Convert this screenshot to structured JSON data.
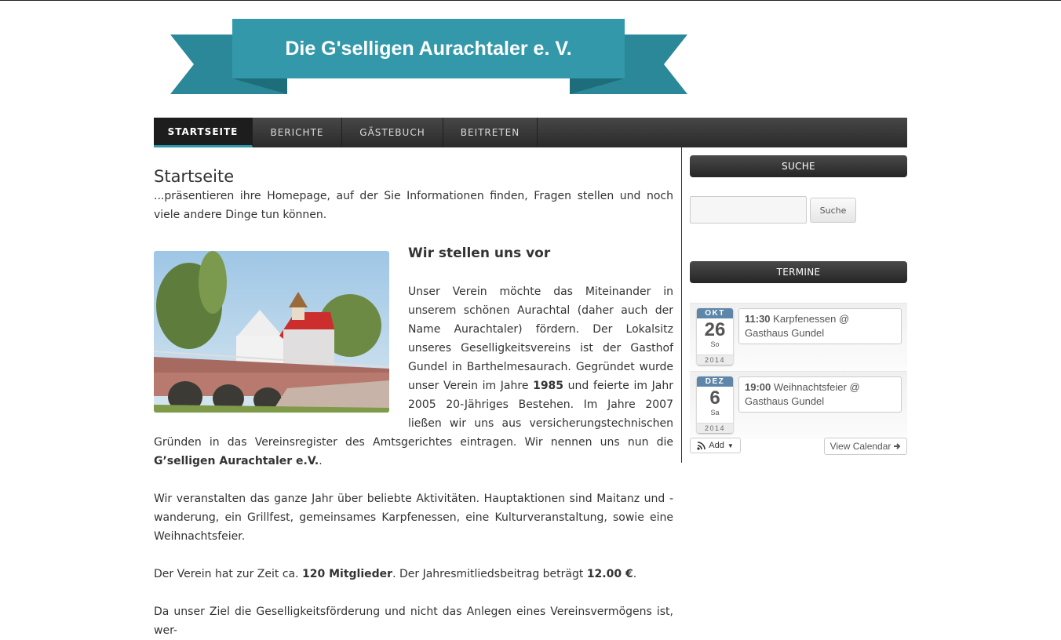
{
  "site": {
    "title": "Die G'selligen Aurachtaler e. V.",
    "banner_color": "#3399aa",
    "banner_dark": "#2a8898"
  },
  "nav": {
    "items": [
      {
        "label": "STARTSEITE",
        "active": true
      },
      {
        "label": "BERICHTE",
        "active": false
      },
      {
        "label": "GÄSTEBUCH",
        "active": false
      },
      {
        "label": "BEITRETEN",
        "active": false
      }
    ]
  },
  "main": {
    "title": "Startseite",
    "intro": "...präsentieren ihre Homepage, auf der Sie Informationen finden, Fragen stellen und noch viele andere Dinge tun können.",
    "section_heading": "Wir stellen uns vor",
    "p1_a": "Unser Verein möchte das Miteinander in unserem schönen Aurachtal (daher auch der Name Aurachtaler) fördern. Der Lokalsitz unseres Geselligkeitsvereins ist der Gasthof Gundel in Barthelmesaurach. Gegründet wurde unser Verein im Jahre ",
    "p1_year": "1985",
    "p1_b": " und feierte im Jahr 2005 20-Jähriges Bestehen. Im Jahre 2007 ließen wir uns aus versicherungstechnischen Gründen in das Vereinsregister des Amtsgerichtes eintragen. Wir nennen uns nun die ",
    "p1_name": "G’selligen Aurachtaler e.V.",
    "p1_c": ".",
    "p2": "Wir veranstalten das ganze Jahr über beliebte Aktivitäten. Hauptaktionen sind Maitanz und -wanderung, ein Grillfest, gemeinsames Karpfenessen, eine Kulturveranstaltung, sowie eine Weihnachtsfeier.",
    "p3_a": "Der Verein hat zur Zeit ca. ",
    "p3_members": "120 Mitglieder",
    "p3_b": ". Der Jahresmitliedsbeitrag beträgt ",
    "p3_fee": "12.00 €",
    "p3_c": ".",
    "p4": "Da unser Ziel die Geselligkeitsförderung und nicht das Anlegen eines Vereinsvermögens ist, wer-"
  },
  "sidebar": {
    "search_header": "SUCHE",
    "search_placeholder": "",
    "search_button": "Suche",
    "termine_header": "TERMINE",
    "events": [
      {
        "month": "OKT",
        "day": "26",
        "weekday": "So",
        "year": "2014",
        "time": "11:30",
        "text": "Karpfenessen @ Gasthaus Gundel"
      },
      {
        "month": "DEZ",
        "day": "6",
        "weekday": "Sa",
        "year": "2014",
        "time": "19:00",
        "text": "Weihnachtsfeier @ Gasthaus Gundel"
      }
    ],
    "add_label": "Add",
    "view_calendar_label": "View Calendar"
  }
}
